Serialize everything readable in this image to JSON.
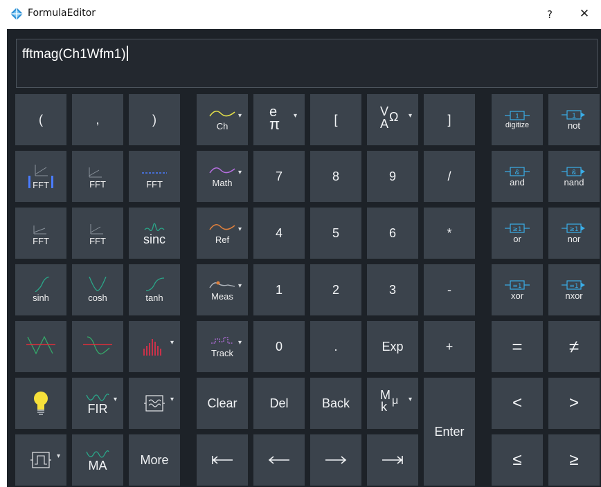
{
  "window": {
    "title": "FormulaEditor",
    "help_label": "?",
    "close_label": "✕"
  },
  "formula": {
    "value": "fftmag(Ch1Wfm1)"
  },
  "keys": {
    "paren_open": "(",
    "comma": ",",
    "paren_close": ")",
    "fft_1": "FFT",
    "fft_2": "FFT",
    "fft_3": "FFT",
    "fft_4": "FFT",
    "fft_5": "FFT",
    "sinc": "sinc",
    "sinh": "sinh",
    "cosh": "cosh",
    "tanh": "tanh",
    "fir": "FIR",
    "ma": "MA",
    "more": "More",
    "ch": "Ch",
    "math": "Math",
    "ref": "Ref",
    "meas": "Meas",
    "track": "Track",
    "clear": "Clear",
    "const_e": "e",
    "const_pi": "π",
    "bracket_open": "[",
    "units_v": "V",
    "units_omega": "Ω",
    "units_a": "A",
    "bracket_close": "]",
    "n7": "7",
    "n8": "8",
    "n9": "9",
    "divide": "/",
    "n4": "4",
    "n5": "5",
    "n6": "6",
    "multiply": "*",
    "n1": "1",
    "n2": "2",
    "n3": "3",
    "minus": "-",
    "n0": "0",
    "dot": ".",
    "exp": "Exp",
    "plus": "+",
    "del": "Del",
    "back": "Back",
    "prefix_m": "M",
    "prefix_mu": "μ",
    "prefix_k": "k",
    "enter": "Enter",
    "digitize": "digitize",
    "not": "not",
    "and": "and",
    "nand": "nand",
    "or": "or",
    "nor": "nor",
    "xor": "xor",
    "nxor": "nxor",
    "equal": "=",
    "not_equal": "≠",
    "less": "<",
    "greater": ">",
    "less_equal": "≤",
    "greater_equal": "≥",
    "gate_1": "1",
    "gate_and": "&",
    "gate_ge1": "≥1",
    "gate_eq1": "=1"
  },
  "icons": {
    "logo": "diamond-logo-icon",
    "ch": "yellow-wave-icon",
    "math": "purple-wave-icon",
    "ref": "orange-wave-icon",
    "meas": "measure-wave-icon",
    "track": "purple-track-icon",
    "bulb": "lightbulb-icon"
  },
  "colors": {
    "background": "#1d2228",
    "key": "#3b434c",
    "ch_wave": "#e8e34a",
    "math_wave": "#b66fe0",
    "ref_wave": "#e0803c",
    "meas_wave": "#b0b6bd",
    "track_wave": "#b66fe0",
    "fft_blue": "#4a7cff",
    "hyp_teal": "#2aa88a",
    "filter_red": "#e0303a",
    "filter_green": "#35a86a",
    "bars_red": "#c8324a",
    "logic_blue": "#3aaee8",
    "bulb_yellow": "#f6e03a"
  }
}
